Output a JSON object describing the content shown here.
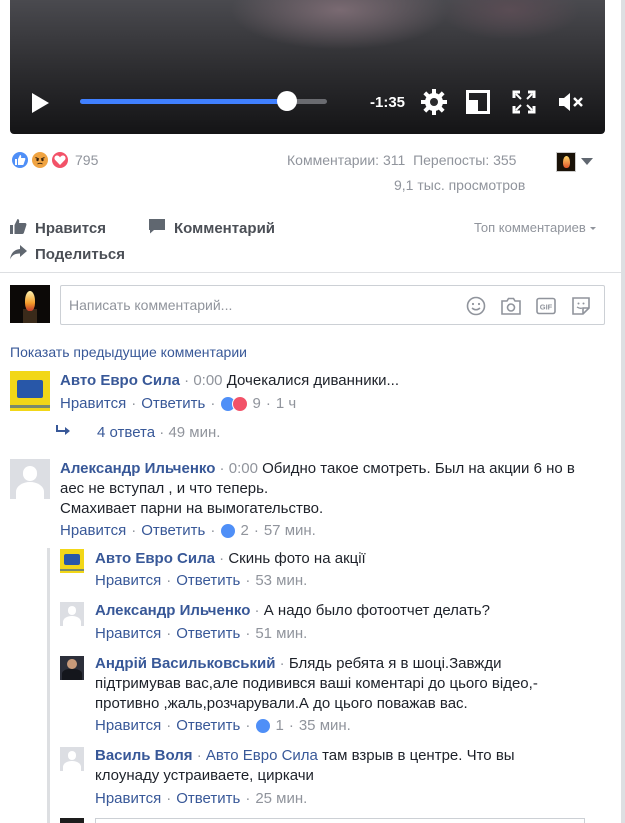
{
  "video": {
    "time": "-1:35",
    "progress": 0.84
  },
  "stats": {
    "reaction_count": "795",
    "comments": "Комментарии: 311",
    "shares": "Перепосты: 355",
    "views": "9,1 тыс. просмотров"
  },
  "actions": {
    "like": "Нравится",
    "comment": "Комментарий",
    "share": "Поделиться",
    "top_comments": "Топ комментариев"
  },
  "composer": {
    "placeholder": "Написать комментарий..."
  },
  "prev_comments": "Показать предыдущие комментарии",
  "comments": [
    {
      "author": "Авто Евро Сила",
      "sep": " · ",
      "time": "0:00",
      "text": "Дочекалися диванники...",
      "like": "Нравится",
      "reply": "Ответить",
      "reactions": "9",
      "age": "1 ч",
      "replies_count": "4 ответа",
      "replies_age": "49 мин."
    },
    {
      "author": "Александр Ильченко",
      "sep": " · ",
      "time": "0:00",
      "text": "Обидно такое смотреть. Был на акции 6 но в аес не вступал , и что теперь.",
      "text2": "Смахивает парни на вымогательство.",
      "like": "Нравится",
      "reply": "Ответить",
      "reactions": "2",
      "age": "57 мин."
    }
  ],
  "replies": [
    {
      "author": "Авто Евро Сила",
      "sep": " · ",
      "text": "Скинь фото на акції",
      "like": "Нравится",
      "reply": "Ответить",
      "age": "53 мин."
    },
    {
      "author": "Александр Ильченко",
      "sep": " · ",
      "text": "А надо было фотоотчет делать?",
      "like": "Нравится",
      "reply": "Ответить",
      "age": "51 мин."
    },
    {
      "author": "Андрій Васильковський",
      "sep": " · ",
      "text": "Блядь ребята я в шоці.Завжди підтримував вас,але подивився ваші коментарі до цього відео,-противно ,жаль,розчарували.А до цього поважав вас.",
      "like": "Нравится",
      "reply": "Ответить",
      "reactions": "1",
      "age": "35 мин."
    },
    {
      "author": "Василь Воля",
      "sep": " · ",
      "tag": "Авто Евро Сила",
      "text": " там взрыв в центре. Что вы клоунаду устраиваете, циркачи",
      "like": "Нравится",
      "reply": "Ответить",
      "age": "25 мин."
    }
  ],
  "colors": {
    "link": "#385898",
    "meta": "#90949c",
    "like_blue": "#4f8ff7",
    "love_red": "#f25268",
    "angry_orange": "#f0a442",
    "seek_fill": "#4080ff"
  }
}
